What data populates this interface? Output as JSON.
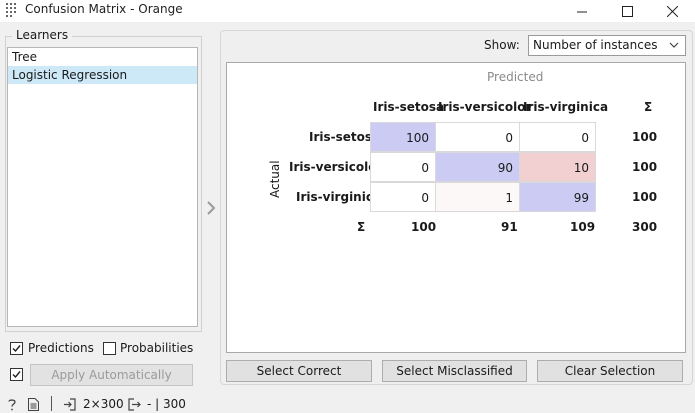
{
  "window": {
    "title": "Confusion Matrix - Orange",
    "icon": "orange-grid-icon"
  },
  "learners": {
    "title": "Learners",
    "items": [
      {
        "label": "Tree",
        "selected": false
      },
      {
        "label": "Logistic Regression",
        "selected": true
      }
    ]
  },
  "options": {
    "predictions_label": "Predictions",
    "predictions_checked": true,
    "probabilities_label": "Probabilities",
    "probabilities_checked": false,
    "auto_checked": true,
    "apply_label": "Apply Automatically"
  },
  "show": {
    "label": "Show:",
    "value": "Number of instances"
  },
  "matrix": {
    "predicted_label": "Predicted",
    "actual_label": "Actual",
    "sum_symbol": "Σ",
    "classes": [
      "Iris-setosa",
      "Iris-versicolor",
      "Iris-virginica"
    ],
    "rows": [
      {
        "cells": [
          "100",
          "0",
          "0"
        ],
        "total": "100"
      },
      {
        "cells": [
          "0",
          "90",
          "10"
        ],
        "total": "100"
      },
      {
        "cells": [
          "0",
          "1",
          "99"
        ],
        "total": "100"
      }
    ],
    "column_totals": [
      "100",
      "91",
      "109"
    ],
    "grand_total": "300",
    "colors": {
      "correct_strong": "#cbcbf4",
      "wrong_strong": "#f2d0d2",
      "wrong_faint": "#fdf8f8",
      "plain": "#ffffff"
    }
  },
  "buttons": {
    "select_correct": "Select Correct",
    "select_misclassified": "Select Misclassified",
    "clear_selection": "Clear Selection"
  },
  "status": {
    "input_summary": "2×300",
    "output_summary": "- | 300"
  }
}
